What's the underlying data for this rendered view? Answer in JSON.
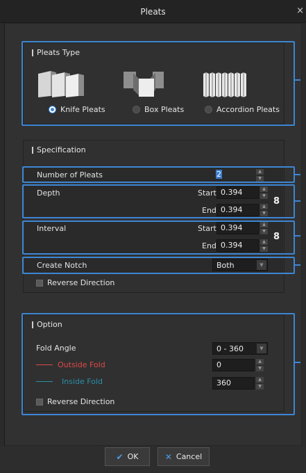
{
  "window": {
    "title": "Pleats",
    "close_glyph": "×"
  },
  "pleats_type": {
    "heading": "Pleats Type",
    "options": [
      {
        "label": "Knife Pleats",
        "selected": true,
        "icon": "knife-pleats-icon"
      },
      {
        "label": "Box Pleats",
        "selected": false,
        "icon": "box-pleats-icon"
      },
      {
        "label": "Accordion Pleats",
        "selected": false,
        "icon": "accordion-pleats-icon"
      }
    ]
  },
  "specification": {
    "heading": "Specification",
    "number_of_pleats": {
      "label": "Number of Pleats",
      "value": "2"
    },
    "depth": {
      "label": "Depth",
      "start_label": "Start",
      "start_value": "0.394",
      "end_label": "End",
      "end_value": "0.394"
    },
    "interval": {
      "label": "Interval",
      "start_label": "Start",
      "start_value": "0.394",
      "end_label": "End",
      "end_value": "0.394"
    },
    "create_notch": {
      "label": "Create Notch",
      "value": "Both"
    },
    "reverse_direction": {
      "label": "Reverse Direction",
      "checked": false
    }
  },
  "option": {
    "heading": "Option",
    "fold_angle": {
      "label": "Fold Angle",
      "value": "0 - 360"
    },
    "outside_fold": {
      "label": "Outside Fold",
      "value": "0",
      "color": "#e04848"
    },
    "inside_fold": {
      "label": "Inside Fold",
      "value": "360",
      "color": "#2a8fa8"
    },
    "reverse_direction": {
      "label": "Reverse Direction",
      "checked": false
    }
  },
  "buttons": {
    "ok_label": "OK",
    "cancel_label": "Cancel"
  },
  "accent_color": "#3d86d4"
}
